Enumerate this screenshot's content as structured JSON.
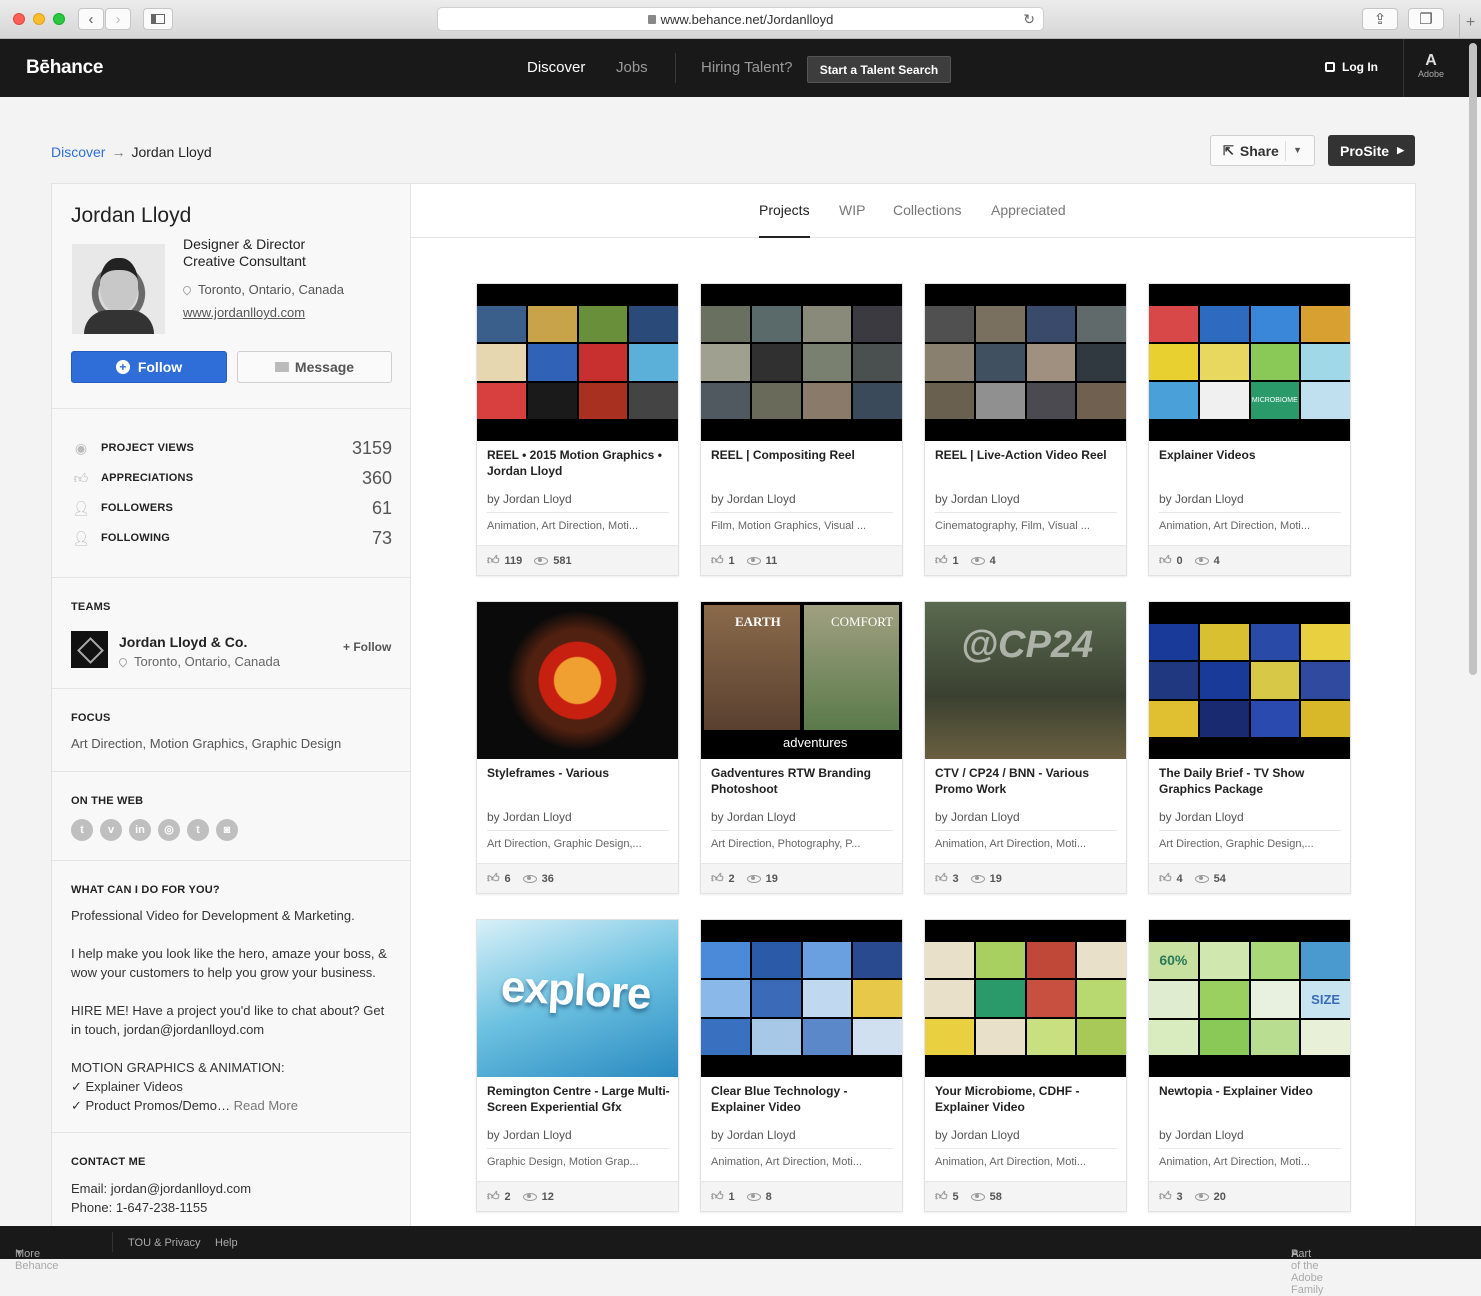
{
  "browser": {
    "url": "www.behance.net/Jordanlloyd"
  },
  "header": {
    "logo": "Bēhance",
    "nav": [
      "Discover",
      "Jobs",
      "Hiring Talent?"
    ],
    "talent_button": "Start a Talent Search",
    "login": "Log In",
    "adobe": "Adobe"
  },
  "breadcrumb": {
    "root": "Discover",
    "arrow": "→",
    "current": "Jordan Lloyd"
  },
  "actions": {
    "share": "Share",
    "prosite": "ProSite"
  },
  "profile": {
    "name": "Jordan Lloyd",
    "occupation_1": "Designer & Director",
    "occupation_2": "Creative Consultant",
    "location": "Toronto, Ontario, Canada",
    "website": "www.jordanlloyd.com",
    "follow": "Follow",
    "message": "Message"
  },
  "stats": [
    {
      "label": "PROJECT VIEWS",
      "value": "3159",
      "icon": "eye-icon"
    },
    {
      "label": "APPRECIATIONS",
      "value": "360",
      "icon": "thumbs-up-icon"
    },
    {
      "label": "FOLLOWERS",
      "value": "61",
      "icon": "user-icon"
    },
    {
      "label": "FOLLOWING",
      "value": "73",
      "icon": "user-icon"
    }
  ],
  "teams": {
    "title": "TEAMS",
    "name": "Jordan Lloyd & Co.",
    "location": "Toronto, Ontario, Canada",
    "follow": "+ Follow"
  },
  "focus": {
    "title": "FOCUS",
    "text": "Art Direction, Motion Graphics, Graphic Design"
  },
  "web": {
    "title": "ON THE WEB",
    "icons": [
      "twitter-icon",
      "vimeo-icon",
      "linkedin-icon",
      "dribbble-icon",
      "tumblr-icon",
      "instagram-icon"
    ]
  },
  "about": {
    "title": "WHAT CAN I DO FOR YOU?",
    "p1": "Professional Video for Development & Marketing.",
    "p2": "I help make you look like the hero, amaze your boss, & wow your customers to help you grow your business.",
    "p3": "HIRE ME! Have a project you'd like to chat about? Get in touch, jordan@jordanlloyd.com",
    "p4_title": "MOTION GRAPHICS & ANIMATION:",
    "p4_l1": "✓ Explainer Videos",
    "p4_l2": "✓ Product Promos/Demo…",
    "read_more": "Read More"
  },
  "contact": {
    "title": "CONTACT ME",
    "email": "Email: jordan@jordanlloyd.com",
    "phone": "Phone: 1-647-238-1155"
  },
  "tabs": [
    "Projects",
    "WIP",
    "Collections",
    "Appreciated"
  ],
  "projects": [
    {
      "title": "REEL • 2015 Motion Graphics • Jordan Lloyd",
      "owner": "by Jordan Lloyd",
      "fields": "Animation, Art Direction, Moti...",
      "likes": "119",
      "views": "581"
    },
    {
      "title": "REEL | Compositing Reel",
      "owner": "by Jordan Lloyd",
      "fields": "Film, Motion Graphics, Visual ...",
      "likes": "1",
      "views": "11"
    },
    {
      "title": "REEL | Live-Action Video Reel",
      "owner": "by Jordan Lloyd",
      "fields": "Cinematography, Film, Visual ...",
      "likes": "1",
      "views": "4"
    },
    {
      "title": "Explainer Videos",
      "owner": "by Jordan Lloyd",
      "fields": "Animation, Art Direction, Moti...",
      "likes": "0",
      "views": "4"
    },
    {
      "title": "Styleframes - Various",
      "owner": "by Jordan Lloyd",
      "fields": "Art Direction, Graphic Design,...",
      "likes": "6",
      "views": "36"
    },
    {
      "title": "Gadventures RTW Branding Photoshoot",
      "owner": "by Jordan Lloyd",
      "fields": "Art Direction, Photography, P...",
      "likes": "2",
      "views": "19"
    },
    {
      "title": "CTV / CP24 / BNN - Various Promo Work",
      "owner": "by Jordan Lloyd",
      "fields": "Animation, Art Direction, Moti...",
      "likes": "3",
      "views": "19"
    },
    {
      "title": "The Daily Brief - TV Show Graphics Package",
      "owner": "by Jordan Lloyd",
      "fields": "Art Direction, Graphic Design,...",
      "likes": "4",
      "views": "54"
    },
    {
      "title": "Remington Centre - Large Multi-Screen Experiential Gfx",
      "owner": "by Jordan Lloyd",
      "fields": "Graphic Design, Motion Grap...",
      "likes": "2",
      "views": "12"
    },
    {
      "title": "Clear Blue Technology - Explainer Video",
      "owner": "by Jordan Lloyd",
      "fields": "Animation, Art Direction, Moti...",
      "likes": "1",
      "views": "8"
    },
    {
      "title": "Your Microbiome, CDHF - Explainer Video",
      "owner": "by Jordan Lloyd",
      "fields": "Animation, Art Direction, Moti...",
      "likes": "5",
      "views": "58"
    },
    {
      "title": "Newtopia - Explainer Video",
      "owner": "by Jordan Lloyd",
      "fields": "Animation, Art Direction, Moti...",
      "likes": "3",
      "views": "20"
    }
  ],
  "thumb_text": {
    "earth": "EARTH",
    "comfort": "COMFORT",
    "adventures": "adventures",
    "cp24": "@CP24",
    "explore": "explore",
    "size": "SIZE",
    "pct": "60%",
    "microbiome": "MICROBIOME"
  },
  "footer": {
    "more": "More Behance",
    "tou": "TOU & Privacy",
    "help": "Help",
    "family": "Part of the Adobe Family"
  }
}
